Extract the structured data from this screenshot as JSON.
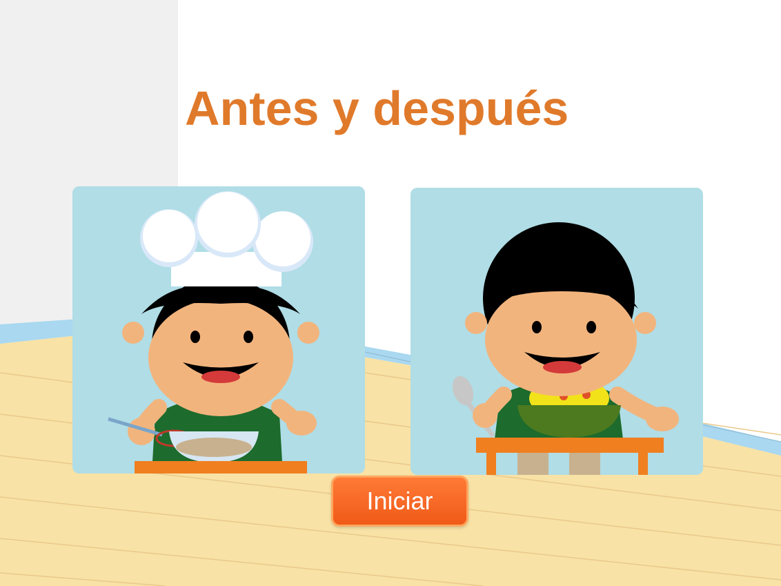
{
  "game": {
    "title": "Antes y después",
    "start_button": "Iniciar"
  },
  "cards": [
    {
      "scene": "chef boy whisking batter in a bowl"
    },
    {
      "scene": "boy holding a spoon with a bowl of spaghetti"
    }
  ],
  "colors": {
    "title": "#e07a2b",
    "button": "#f26522",
    "card_background": "#b0dde6",
    "floor": "#f8e2a6",
    "wall_left": "#f0f0f0",
    "baseboard": "#a9d8f0"
  }
}
